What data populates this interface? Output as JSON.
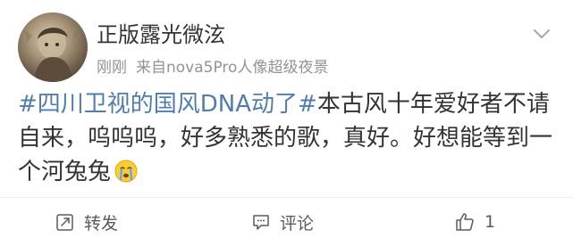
{
  "post": {
    "username": "正版露光微泫",
    "time": "刚刚",
    "source": "来自nova5Pro人像超级夜景",
    "content": {
      "topic": "#四川卫视的国风DNA动了#",
      "text": "本古风十年爱好者不请自来，呜呜呜，好多熟悉的歌，真好。好想能等到一个河兔兔",
      "emoji": "crying-face-emoji"
    }
  },
  "actions": {
    "repost_label": "转发",
    "comment_label": "评论",
    "like_count": "1"
  },
  "colors": {
    "topic": "#507daf",
    "meta": "#939393",
    "text": "#333333"
  }
}
